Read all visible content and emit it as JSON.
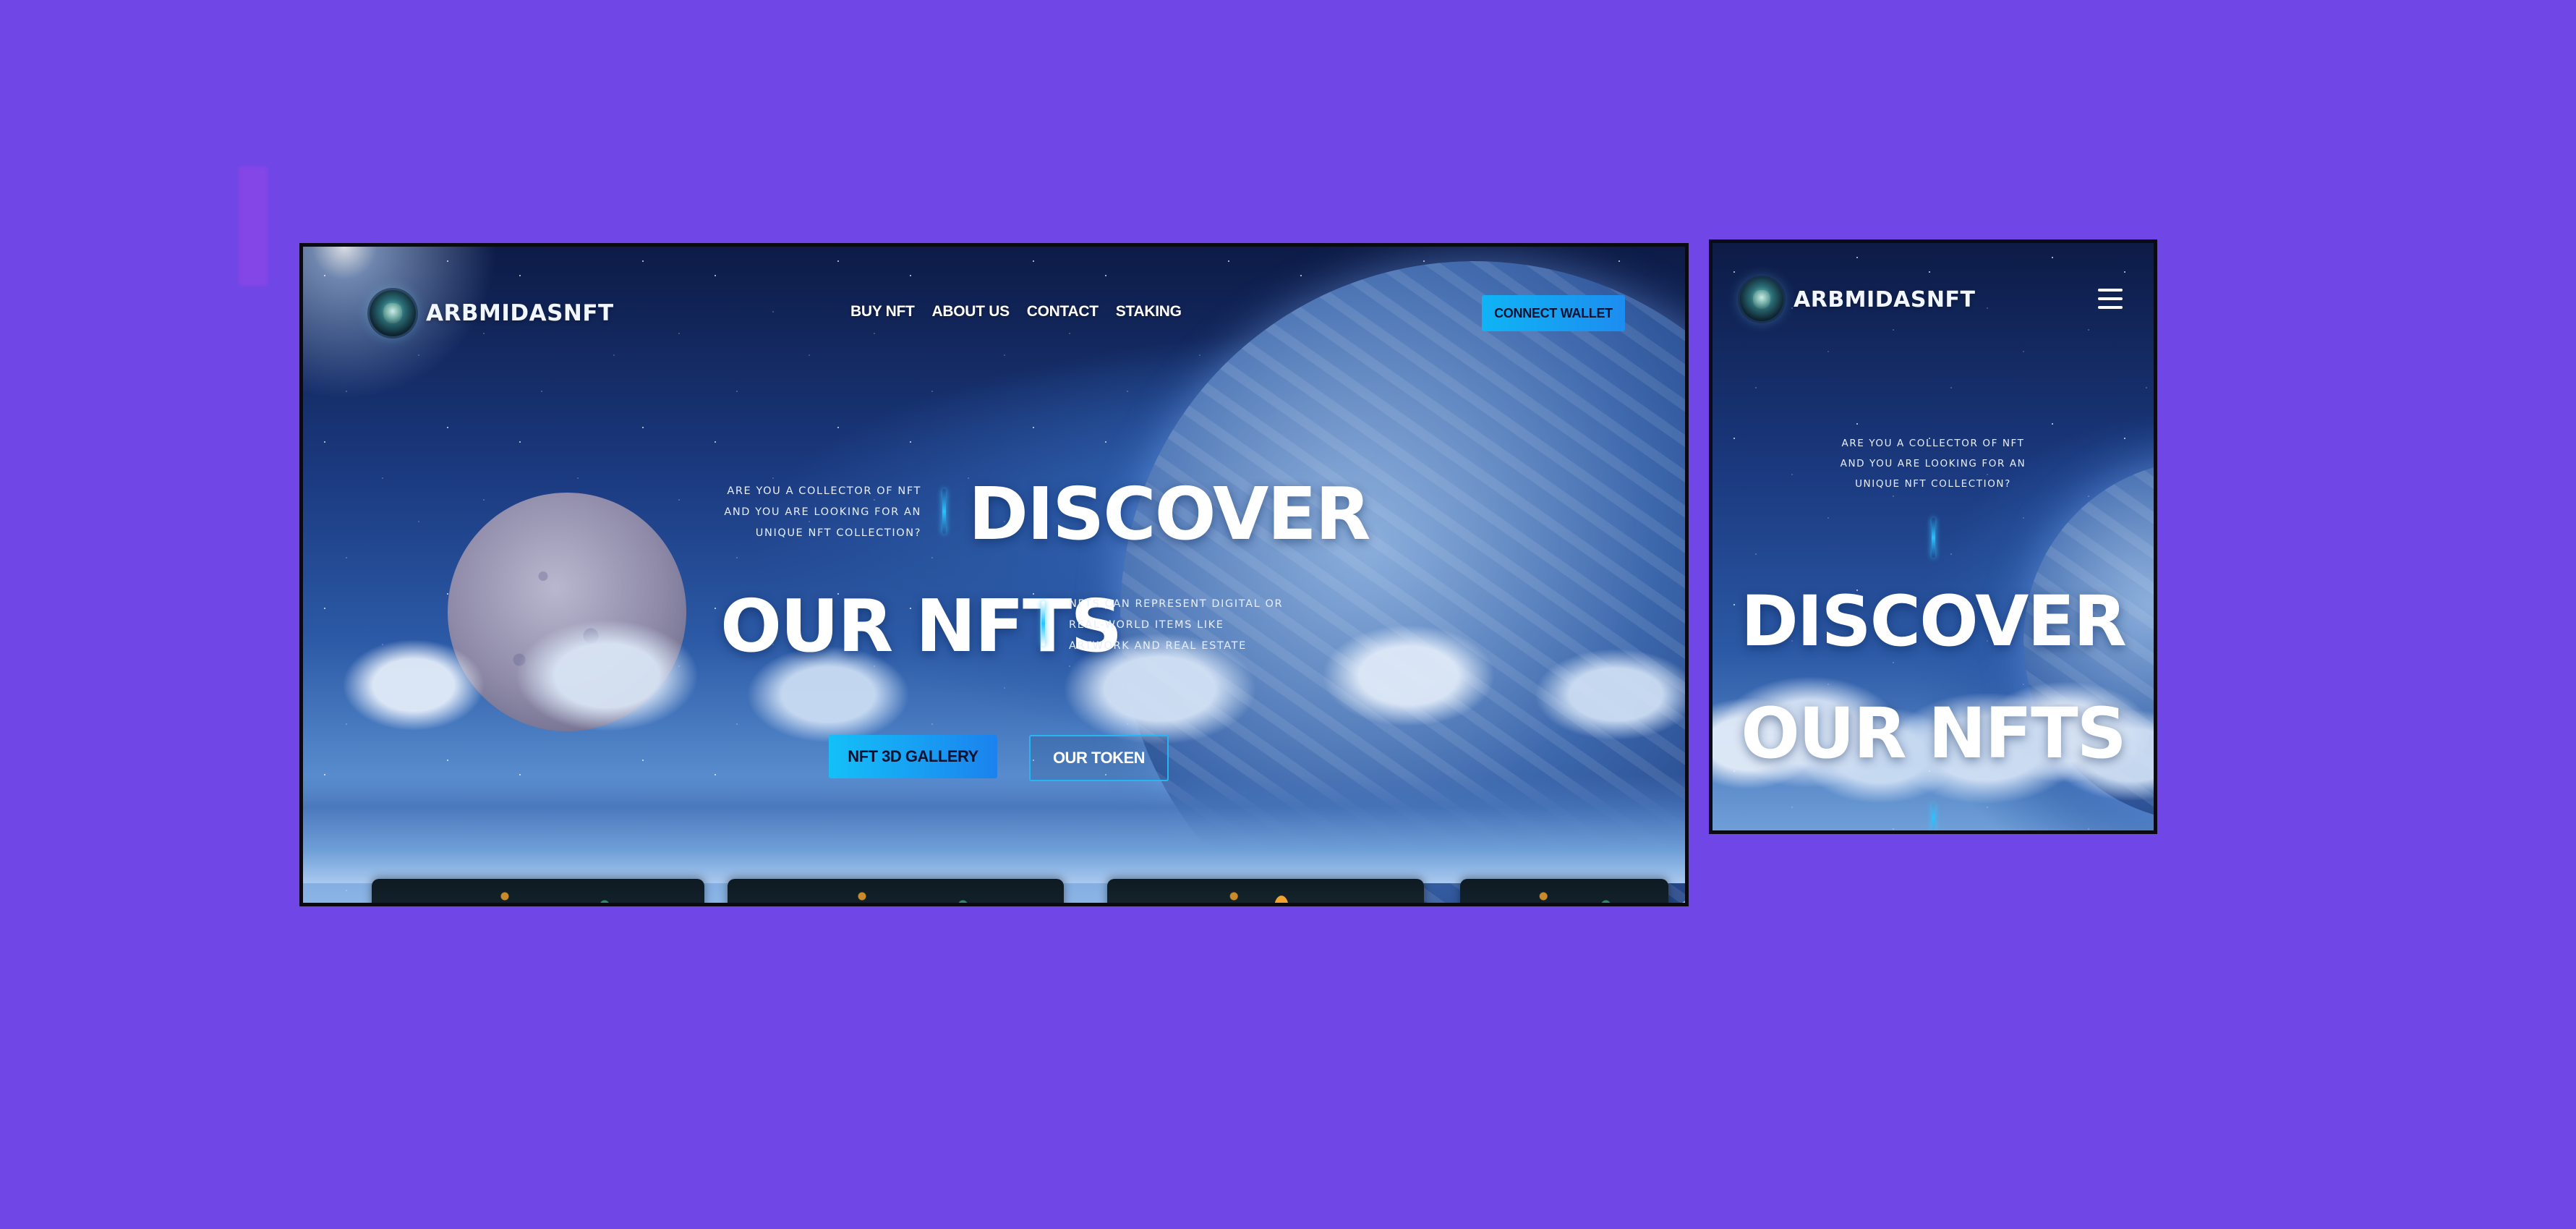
{
  "brand": {
    "name": "ARBMIDASNFT"
  },
  "nav": {
    "items": [
      "BUY NFT",
      "ABOUT US",
      "CONTACT",
      "STAKING"
    ],
    "connect_label": "CONNECT WALLET"
  },
  "hero": {
    "intro_lines": [
      "ARE YOU A COLLECTOR OF NFT",
      "AND YOU ARE LOOKING FOR AN",
      "UNIQUE NFT COLLECTION?"
    ],
    "title_line1": "DISCOVER",
    "title_line2": "OUR NFTS",
    "side_lines": [
      "NFTS CAN REPRESENT DIGITAL OR",
      "REAL-WORLD ITEMS LIKE",
      "ARTWORK AND REAL ESTATE"
    ],
    "gallery_button": "NFT 3D GALLERY",
    "token_button": "OUR TOKEN"
  },
  "mobile": {
    "brand": "ARBMIDASNFT",
    "menu_icon": "hamburger-icon",
    "intro_lines": [
      "ARE YOU A COLLECTOR OF NFT",
      "AND YOU ARE LOOKING FOR AN",
      "UNIQUE NFT COLLECTION?"
    ],
    "title_line1": "DISCOVER",
    "title_line2": "OUR NFTS"
  },
  "colors": {
    "page_background": "#7047e6",
    "accent": "#1aa9f3",
    "frame_border": "#0a0a14"
  }
}
